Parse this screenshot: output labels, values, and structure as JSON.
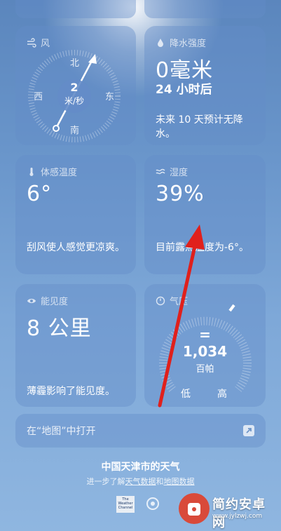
{
  "wind": {
    "title": "风",
    "speed": "2",
    "unit": "米/秒",
    "north": "北",
    "south": "南",
    "east": "东",
    "west": "西",
    "icon": "wind-icon"
  },
  "precipitation": {
    "title": "降水强度",
    "value": "0毫米",
    "period": "24 小时后",
    "note": "未来 10 天预计无降水。",
    "icon": "raindrop-icon"
  },
  "feels_like": {
    "title": "体感温度",
    "value": "6°",
    "note": "刮风使人感觉更凉爽。",
    "icon": "thermometer-icon"
  },
  "humidity": {
    "title": "湿度",
    "value": "39%",
    "note": "目前露点温度为-6°。",
    "icon": "humidity-icon"
  },
  "visibility": {
    "title": "能见度",
    "value": "8 公里",
    "note": "薄霾影响了能见度。",
    "icon": "eye-icon"
  },
  "pressure": {
    "title": "气压",
    "trend": "=",
    "value": "1,034",
    "unit": "百帕",
    "low": "低",
    "high": "高",
    "icon": "gauge-icon"
  },
  "maps_link": {
    "label": "在“地图”中打开",
    "icon": "external-link-icon"
  },
  "footer": {
    "title": "中国天津市的天气",
    "sub_prefix": "进一步了解",
    "sub_link1": "天气数据",
    "sub_mid": "和",
    "sub_link2": "地图数据"
  },
  "twc_logo": "The Weather Channel",
  "watermark": {
    "title": "简约安卓网",
    "url": "www.jylzwj.com"
  },
  "colors": {
    "card": "#6e95c8",
    "arrow": "#e0201c"
  }
}
